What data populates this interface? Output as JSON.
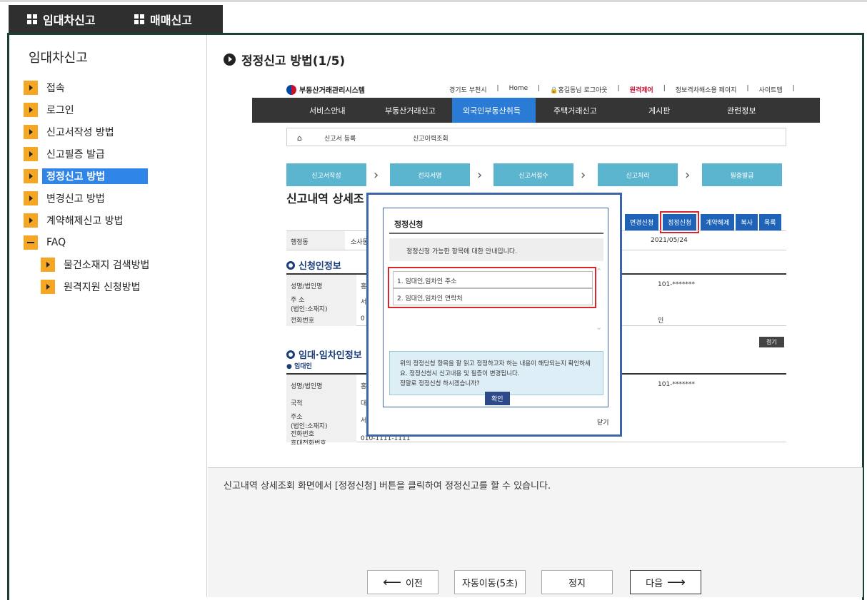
{
  "tabs": [
    {
      "label": "임대차신고"
    },
    {
      "label": "매매신고"
    }
  ],
  "sidebar": {
    "title": "임대차신고",
    "items": [
      {
        "label": "접속"
      },
      {
        "label": "로그인"
      },
      {
        "label": "신고서작성 방법"
      },
      {
        "label": "신고필증 발급"
      },
      {
        "label": "정정신고 방법"
      },
      {
        "label": "변경신고 방법"
      },
      {
        "label": "계약해제신고 방법"
      },
      {
        "label": "FAQ"
      },
      {
        "label": "물건소재지 검색방법"
      },
      {
        "label": "원격지원 신청방법"
      }
    ]
  },
  "main": {
    "title": "정정신고 방법(1/5)"
  },
  "screenshot": {
    "logo": "부동산거래관리시스템",
    "links": [
      "경기도 부천시",
      "Home",
      "홍길동님 로그아웃",
      "원격제어",
      "정보격차해소용 페이지",
      "사이트맵"
    ],
    "nav": [
      "서비스안내",
      "부동산거래신고",
      "외국인부동산취득",
      "주택거래신고",
      "게시판",
      "관련정보"
    ],
    "breadcrumb": [
      "신고서 등록",
      "신고이력조회"
    ],
    "steps": [
      "신고서작성",
      "전자서명",
      "신고서접수",
      "신고처리",
      "필증발급"
    ],
    "heading": "신고내역 상세조",
    "actions": [
      "변경신청",
      "정정신청",
      "계약해제",
      "복사",
      "목록"
    ],
    "row1": {
      "label": "행정동",
      "value": "소사동",
      "date": "2021/05/24"
    },
    "section1": "신청인정보",
    "rows1": [
      "성명/법인명",
      "주 소\n(법인:소재지)",
      "전화번호"
    ],
    "mask1": "101-*******",
    "tail1": "인",
    "fold": "접기",
    "section2": "임대·임차인정보",
    "subsection2": "임대인",
    "rows2": [
      "성명/법인명",
      "국적",
      "주소\n(법인:소재지)",
      "전화번호\n휴대전화번호"
    ],
    "mask2": "101-*******",
    "phone": "010-1111-1111",
    "cells": {
      "a": "홍",
      "b": "서",
      "c": "0",
      "d": "홍",
      "e": "대",
      "f": "서"
    }
  },
  "modal": {
    "title": "정정신청",
    "info": "정정신청 가능한 항목에 대한 안내입니다.",
    "items": [
      "1. 임대인,임차인 주소",
      "2. 임대인,임차인 연락처"
    ],
    "note": "위의 정정신청 항목을 잘 읽고 정정하고자 하는 내용이 해당되는지 확인하세요. 정정신청시 신고내용 및 필증이 변경됩니다.\n정말로 정정신청 하시겠습니까?",
    "ok": "확인",
    "close": "닫기"
  },
  "description": "신고내역 상세조회 화면에서 [정정신청] 버튼을 클릭하여 정정신고를 할 수 있습니다.",
  "pager": {
    "prev": "이전",
    "auto": "자동이동(5초)",
    "stop": "정지",
    "next": "다음"
  }
}
